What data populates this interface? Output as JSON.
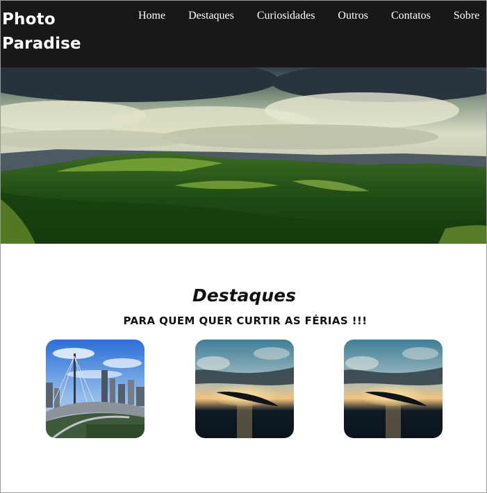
{
  "header": {
    "logo_line1": "Photo",
    "logo_line2": "Paradise",
    "nav": [
      {
        "label": "Home"
      },
      {
        "label": "Destaques"
      },
      {
        "label": "Curiosidades"
      },
      {
        "label": "Outros"
      },
      {
        "label": "Contatos"
      },
      {
        "label": "Sobre"
      }
    ]
  },
  "hero": {
    "image": "landscape-hills-forest-clouds"
  },
  "featured": {
    "title": "Destaques",
    "subtitle": "PARA QUEM QUER CURTIR AS FÉRIAS !!!",
    "cards": [
      {
        "image": "city-skyline-bridge"
      },
      {
        "image": "sunset-sea-island"
      },
      {
        "image": "sunset-sea-island"
      }
    ]
  },
  "colors": {
    "header_bg": "#18181b",
    "nav_text": "#ffffff",
    "page_bg": "#ffffff",
    "heading": "#111111"
  }
}
